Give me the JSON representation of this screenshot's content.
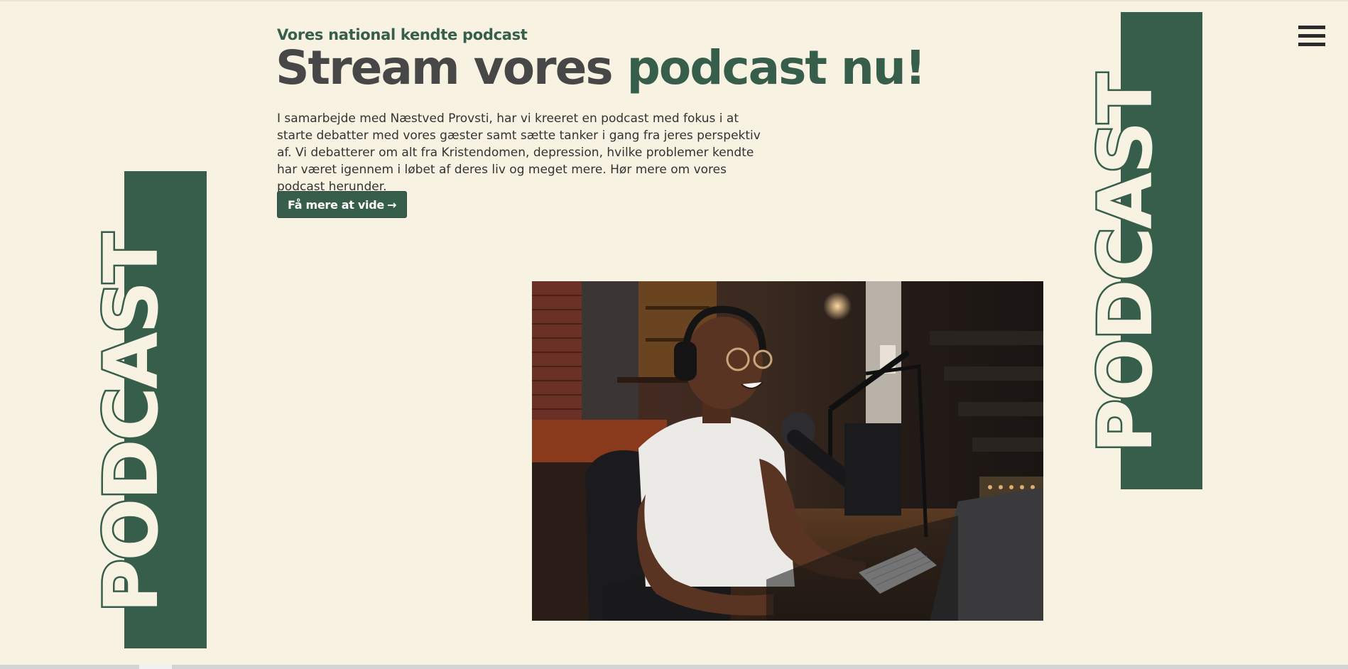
{
  "hero": {
    "eyebrow": "Vores national kendte podcast",
    "headline_part1": "Stream vores ",
    "headline_part2": "podcast nu!",
    "body": "I samarbejde med Næstved Provsti, har vi kreeret en podcast med fokus i at starte debatter med vores gæster samt sætte tanker i gang fra jeres perspektiv af. Vi debatterer om alt fra Kristendomen, depression, hvilke problemer kendte har været igennem i løbet af deres liv og meget mere. Hør mere om vores podcast herunder.",
    "cta_label": "Få mere at vide",
    "cta_arrow": "→"
  },
  "side_labels": {
    "left": "PODCAST",
    "right": "PODCAST"
  },
  "nav": {
    "menu_icon": "hamburger-menu-icon"
  },
  "colors": {
    "background": "#f8f2e2",
    "brand_green": "#365e4b",
    "headline_dark": "#474747",
    "body_text": "#333333"
  }
}
